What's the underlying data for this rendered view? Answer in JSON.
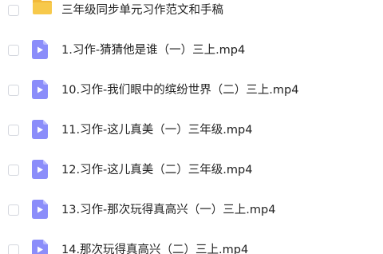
{
  "colors": {
    "folder": "#f7c94b",
    "folder_tab": "#f2b93a",
    "video": "#8b8dfa",
    "video_fold": "#b7b8fc",
    "text": "#222222",
    "checkbox_border": "#d4d7de"
  },
  "files": [
    {
      "type": "folder",
      "icon": "folder-icon",
      "name": "三年级同步单元习作范文和手稿"
    },
    {
      "type": "video",
      "icon": "video-file-icon",
      "name": "1.习作-猜猜他是谁（一）三上.mp4"
    },
    {
      "type": "video",
      "icon": "video-file-icon",
      "name": "10.习作-我们眼中的缤纷世界（二）三上.mp4"
    },
    {
      "type": "video",
      "icon": "video-file-icon",
      "name": "11.习作-这儿真美（一）三年级.mp4"
    },
    {
      "type": "video",
      "icon": "video-file-icon",
      "name": "12.习作-这儿真美（二）三年级.mp4"
    },
    {
      "type": "video",
      "icon": "video-file-icon",
      "name": "13.习作-那次玩得真高兴（一）三上.mp4"
    },
    {
      "type": "video",
      "icon": "video-file-icon",
      "name": "14.那次玩得真高兴（二）三上.mp4"
    }
  ]
}
